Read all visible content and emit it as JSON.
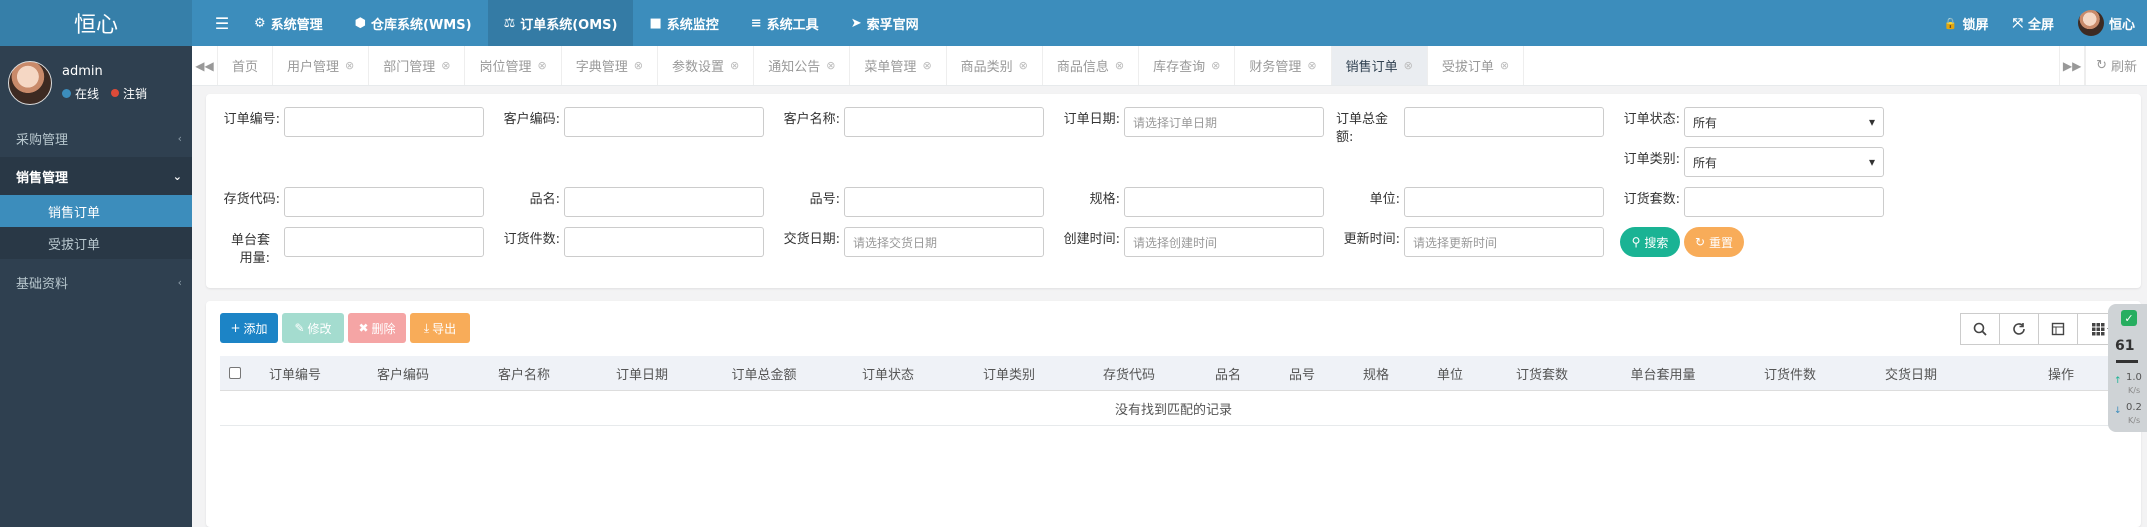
{
  "app": {
    "logo": "恒心"
  },
  "user": {
    "name": "admin",
    "online": "在线",
    "logout": "注销"
  },
  "sidebar": {
    "items": [
      {
        "label": "采购管理",
        "chevron": "‹"
      },
      {
        "label": "销售管理",
        "chevron": "⌄"
      },
      {
        "label": "销售订单"
      },
      {
        "label": "受拔订单"
      },
      {
        "label": "基础资料",
        "chevron": "‹"
      }
    ]
  },
  "topnav": {
    "toggle_icon": "☰",
    "items": [
      {
        "icon": "⚙",
        "label": "系统管理"
      },
      {
        "icon": "⬢",
        "label": "仓库系统(WMS)"
      },
      {
        "icon": "⚖",
        "label": "订单系统(OMS)"
      },
      {
        "icon": "■",
        "label": "系统监控"
      },
      {
        "icon": "≡",
        "label": "系统工具"
      },
      {
        "icon": "➤",
        "label": "索孚官网"
      }
    ],
    "right": [
      {
        "icon": "🔒",
        "label": "锁屏"
      },
      {
        "icon": "⤧",
        "label": "全屏"
      },
      {
        "label": "恒心"
      }
    ]
  },
  "tabs": {
    "items": [
      {
        "label": "首页"
      },
      {
        "label": "用户管理"
      },
      {
        "label": "部门管理"
      },
      {
        "label": "岗位管理"
      },
      {
        "label": "字典管理"
      },
      {
        "label": "参数设置"
      },
      {
        "label": "通知公告"
      },
      {
        "label": "菜单管理"
      },
      {
        "label": "商品类别"
      },
      {
        "label": "商品信息"
      },
      {
        "label": "库存查询"
      },
      {
        "label": "财务管理"
      },
      {
        "label": "销售订单"
      },
      {
        "label": "受拔订单"
      }
    ],
    "close_icon": "⊗",
    "left_arrow": "◀◀",
    "right_arrow": "▶▶",
    "refresh_icon": "↻",
    "refresh_label": "刷新"
  },
  "search": {
    "order_no": {
      "label": "订单编号:",
      "value": ""
    },
    "customer_code": {
      "label": "客户编码:",
      "value": ""
    },
    "customer_name": {
      "label": "客户名称:",
      "value": ""
    },
    "order_date": {
      "label": "订单日期:",
      "placeholder": "请选择订单日期"
    },
    "order_total": {
      "label": "订单总金额:",
      "value": ""
    },
    "order_status": {
      "label": "订单状态:",
      "selected": "所有"
    },
    "order_type": {
      "label": "订单类别:",
      "selected": "所有"
    },
    "stock_code": {
      "label": "存货代码:",
      "value": ""
    },
    "product_name": {
      "label": "品名:",
      "value": ""
    },
    "product_no": {
      "label": "品号:",
      "value": ""
    },
    "spec": {
      "label": "规格:",
      "value": ""
    },
    "unit": {
      "label": "单位:",
      "value": ""
    },
    "order_sets": {
      "label": "订货套数:",
      "value": ""
    },
    "unit_usage": {
      "label": "单台套用量:",
      "value": ""
    },
    "order_pieces": {
      "label": "订货件数:",
      "value": ""
    },
    "delivery_date": {
      "label": "交货日期:",
      "placeholder": "请选择交货日期"
    },
    "created_at": {
      "label": "创建时间:",
      "placeholder": "请选择创建时间"
    },
    "updated_at": {
      "label": "更新时间:",
      "placeholder": "请选择更新时间"
    },
    "search_button": "搜索",
    "reset_button": "重置",
    "dropdown_icon": "▾"
  },
  "toolbar": {
    "add": "添加",
    "edit": "修改",
    "delete": "删除",
    "export": "导出",
    "tool_icons": [
      "search-icon",
      "refresh-icon",
      "columns-icon",
      "grid-icon"
    ]
  },
  "table": {
    "columns": [
      "订单编号",
      "客户编码",
      "客户名称",
      "订单日期",
      "订单总金额",
      "订单状态",
      "订单类别",
      "存货代码",
      "品名",
      "品号",
      "规格",
      "单位",
      "订货套数",
      "单台套用量",
      "订货件数",
      "交货日期",
      "操作"
    ],
    "empty_text": "没有找到匹配的记录"
  },
  "widget": {
    "percent": "61",
    "up": "1.0",
    "down": "0.2",
    "unit": "K/s"
  },
  "colors": {
    "topbar": "#3c8dbc",
    "sidebar": "#2f4050",
    "selected": "#3c8dbc",
    "primary": "#1c84c6",
    "success": "#1ab394",
    "warning": "#f8ac59"
  }
}
